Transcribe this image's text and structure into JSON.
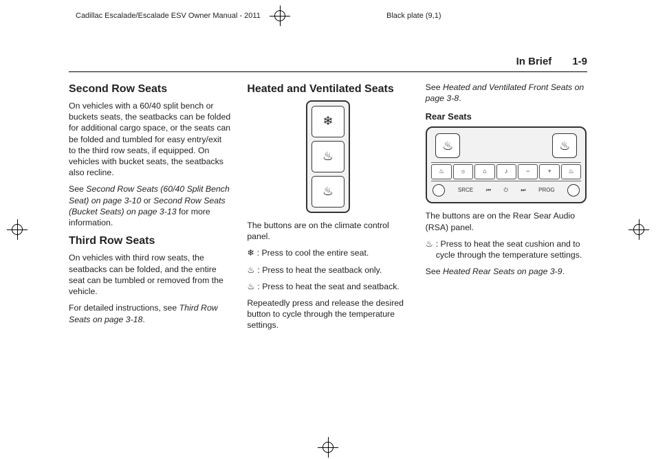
{
  "top": {
    "left": "Cadillac Escalade/Escalade ESV Owner Manual - 2011",
    "right": "Black plate (9,1)"
  },
  "header": {
    "section": "In Brief",
    "page": "1-9"
  },
  "col1": {
    "h_second": "Second Row Seats",
    "second_p": "On vehicles with a 60/40 split bench or buckets seats, the seatbacks can be folded for additional cargo space, or the seats can be folded and tumbled for easy entry/exit to the third row seats, if equipped. On vehicles with bucket seats, the seatbacks also recline.",
    "second_see_pre": "See ",
    "second_see_ref1": "Second Row Seats (60/40 Split Bench Seat) on page 3-10",
    "second_see_mid": " or ",
    "second_see_ref2": "Second Row Seats (Bucket Seats) on page 3-13",
    "second_see_post": " for more information.",
    "h_third": "Third Row Seats",
    "third_p": "On vehicles with third row seats, the seatbacks can be folded, and the entire seat can be tumbled or removed from the vehicle.",
    "third_see_pre": "For detailed instructions, see ",
    "third_see_ref": "Third Row Seats on page 3-18",
    "third_see_post": "."
  },
  "col2": {
    "h_hv": "Heated and Ventilated Seats",
    "climate_caption": "The buttons are on the climate control panel.",
    "btn_cool_icon": "❄",
    "btn_cool_text": " :  Press to cool the entire seat.",
    "btn_back_icon": "♨",
    "btn_back_text": " :  Press to heat the seatback only.",
    "btn_seat_icon": "♨",
    "btn_seat_text": " :  Press to heat the seat and seatback.",
    "repeat": "Repeatedly press and release the desired button to cycle through the temperature settings."
  },
  "col3": {
    "see_hv_pre": "See ",
    "see_hv_ref": "Heated and Ventilated Front Seats on page 3-8",
    "see_hv_post": ".",
    "h_rear": "Rear Seats",
    "rsa_caption": "The buttons are on the Rear Sear Audio (RSA) panel.",
    "rear_icon": "♨",
    "rear_icon_text": " :  Press to heat the seat cushion and to cycle through the temperature settings.",
    "see_rear_pre": "See ",
    "see_rear_ref": "Heated Rear Seats on page 3-9",
    "see_rear_post": "."
  },
  "fig1": {
    "btn1": "❄",
    "btn2": "♨",
    "btn3": "♨"
  },
  "rsa": {
    "hp_left_icon": "♨",
    "hp_right_icon": "♨",
    "row": [
      "♨",
      "☼",
      "⌂",
      "♪",
      "−",
      "+",
      "♨"
    ],
    "bottom_left": "SRCE",
    "mid1": "⏮",
    "mid2": "⏻",
    "mid3": "⏭",
    "bottom_right": "PROG"
  }
}
